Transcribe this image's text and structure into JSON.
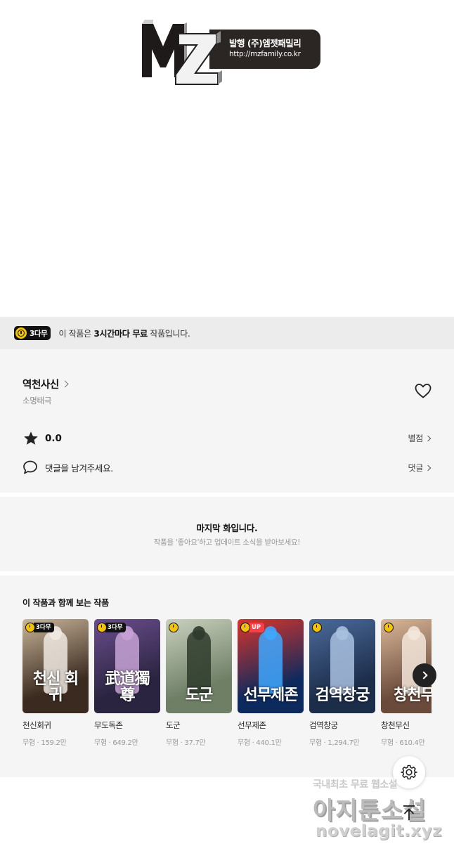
{
  "logo": {
    "mark": "MZ",
    "publisher": "발행 (주)엠젯패밀리",
    "url": "http://mzfamily.co.kr"
  },
  "free_banner": {
    "badge": "3다무",
    "text_before": "이 작품은 ",
    "text_bold": "3시간마다 무료",
    "text_after": " 작품입니다."
  },
  "work": {
    "title": "역천사신",
    "author": "소명태극",
    "rating": "0.0",
    "rate_link": "별점",
    "comment_prompt": "댓글을 남겨주세요.",
    "comment_link": "댓글"
  },
  "last_episode": {
    "title": "마지막 화입니다.",
    "subtitle": "작품을 '좋아요'하고 업데이트 소식을 받아보세요!"
  },
  "recommendations": {
    "heading": "이 작품과 함께 보는 작품",
    "items": [
      {
        "title": "천신회귀",
        "meta": "무협 · 159.2만",
        "badge": "3다무",
        "cover_text": "천신\n회귀",
        "colors": [
          "#3a2a1f",
          "#c9b59a",
          "#efe9e2"
        ]
      },
      {
        "title": "무도독존",
        "meta": "무협 · 649.2만",
        "badge": "3다무",
        "cover_text": "武道獨尊",
        "colors": [
          "#2a2440",
          "#6a4d8c",
          "#c7a2d6"
        ]
      },
      {
        "title": "도군",
        "meta": "무협 · 37.7만",
        "badge": "",
        "cover_text": "도군",
        "colors": [
          "#6f7f66",
          "#c9d1be",
          "#2e3b2c"
        ]
      },
      {
        "title": "선무제존",
        "meta": "무협 · 440.1만",
        "badge": "UP",
        "cover_text": "선무제존",
        "colors": [
          "#0d2a5e",
          "#d9342b",
          "#3fa7ff"
        ]
      },
      {
        "title": "검역창궁",
        "meta": "무협 · 1,294.7만",
        "badge": "",
        "cover_text": "검역창궁",
        "colors": [
          "#1c2d4a",
          "#4b6a9a",
          "#a9c1e0"
        ]
      },
      {
        "title": "창천무신",
        "meta": "무협 · 610.4만",
        "badge": "",
        "cover_text": "창천무",
        "colors": [
          "#6a4a3a",
          "#d9b89a",
          "#f3e6da"
        ]
      }
    ]
  },
  "watermark": {
    "line1": "국내최초 무료 웹소설",
    "line2": "아지툰소설",
    "line3": "novelagit.xyz"
  },
  "icons": {
    "heart": "heart-icon",
    "star": "star-icon",
    "comment": "comment-icon",
    "settings": "gear-icon",
    "scroll_top": "arrow-up-icon",
    "next": "chevron-right-icon"
  }
}
